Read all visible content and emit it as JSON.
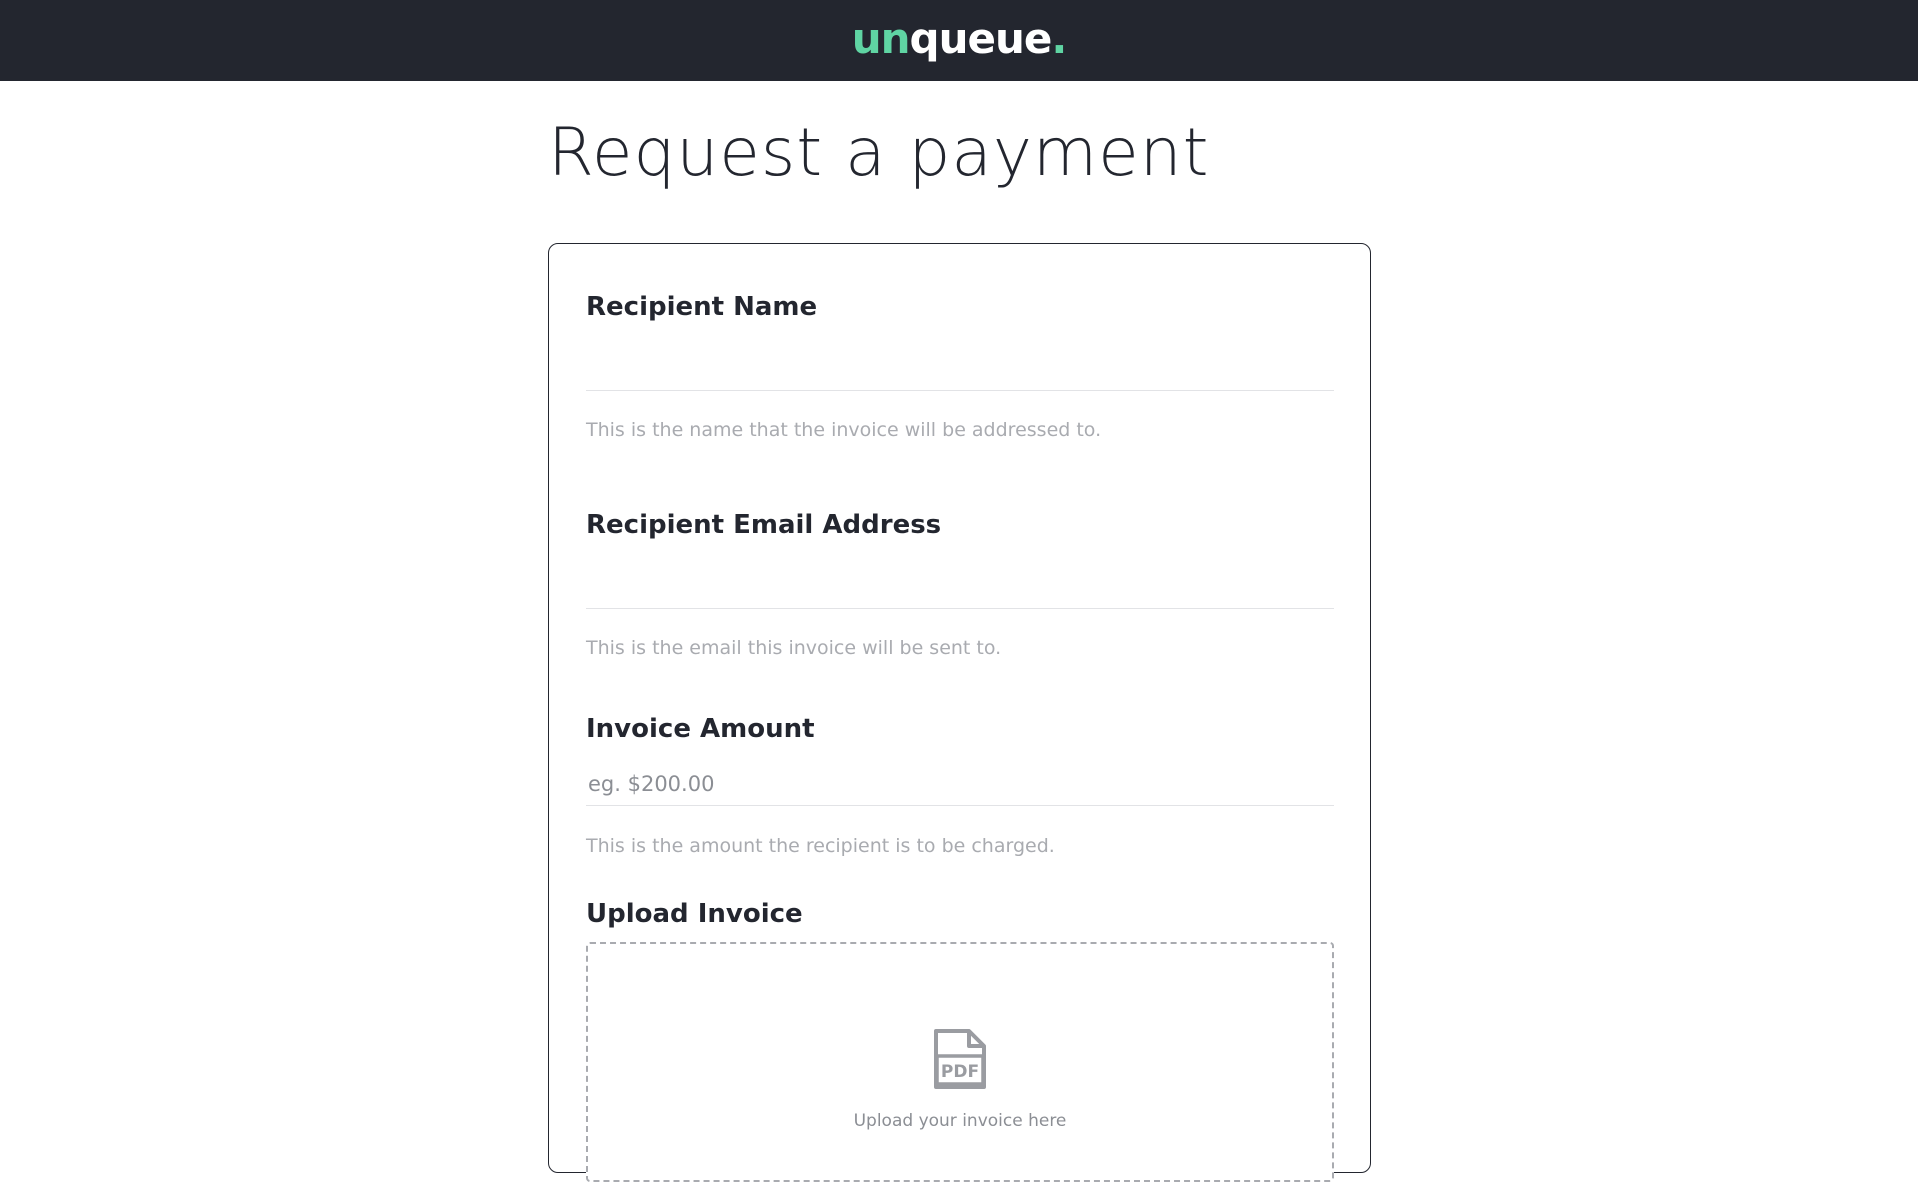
{
  "header": {
    "logo_part1": "un",
    "logo_part2": "queue",
    "logo_dot": ".",
    "brand_color": "#5fd4a3",
    "background_color": "#23262f"
  },
  "page": {
    "title": "Request a payment"
  },
  "form": {
    "recipient_name": {
      "label": "Recipient Name",
      "value": "",
      "placeholder": "",
      "help": "This is the name that the invoice will be addressed to."
    },
    "recipient_email": {
      "label": "Recipient Email Address",
      "value": "",
      "placeholder": "",
      "help": "This is the email this invoice will be sent to."
    },
    "invoice_amount": {
      "label": "Invoice Amount",
      "value": "",
      "placeholder": "eg. $200.00",
      "help": "This is the amount the recipient is to be charged."
    },
    "upload_invoice": {
      "label": "Upload Invoice",
      "icon": "pdf-file-icon",
      "icon_text": "PDF",
      "dropzone_text": "Upload your invoice here"
    }
  }
}
